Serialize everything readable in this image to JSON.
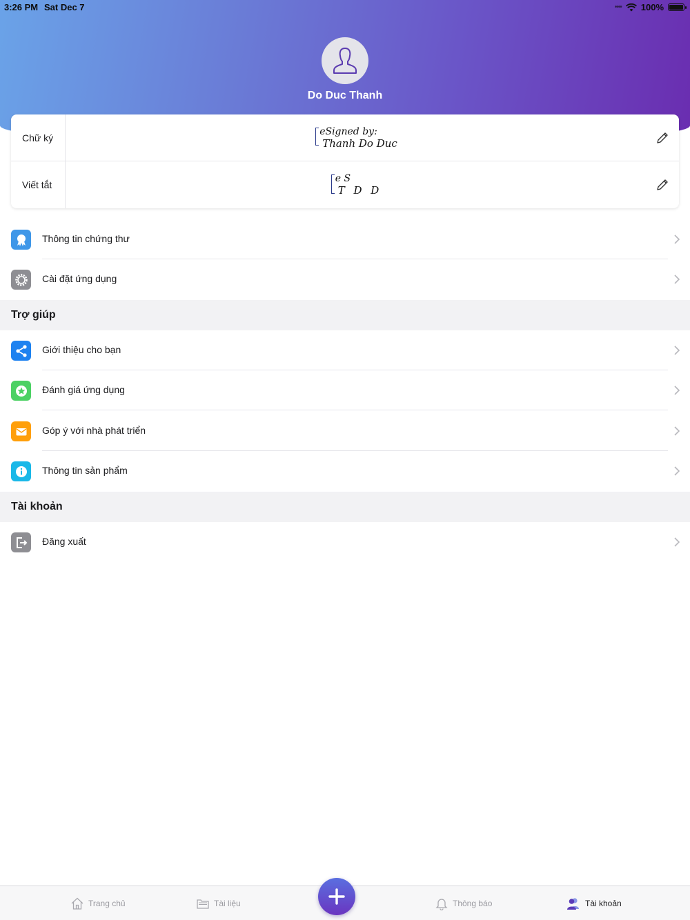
{
  "status_bar": {
    "time": "3:26 PM",
    "date": "Sat Dec 7",
    "battery": "100%"
  },
  "profile": {
    "name": "Do Duc Thanh"
  },
  "signature_card": {
    "signature_label": "Chữ ký",
    "initials_label": "Viết tắt",
    "signature_line1": "eSigned by:",
    "signature_line2": "Thanh Do Duc",
    "initials_line1": "e S",
    "initials_line2": "T D D"
  },
  "menu_main": [
    {
      "label": "Thông tin chứng thư",
      "icon": "certificate-icon",
      "color": "#3f97e8"
    },
    {
      "label": "Cài đặt ứng dụng",
      "icon": "gear-icon",
      "color": "#8e8e93"
    }
  ],
  "section_help": {
    "title": "Trợ giúp"
  },
  "menu_help": [
    {
      "label": "Giới thiệu cho bạn",
      "icon": "share-icon",
      "color": "#1e82f0"
    },
    {
      "label": "Đánh giá ứng dụng",
      "icon": "star-icon",
      "color": "#4cd164"
    },
    {
      "label": "Góp ý với nhà phát triển",
      "icon": "mail-icon",
      "color": "#ff9f0a"
    },
    {
      "label": "Thông tin sản phẩm",
      "icon": "info-icon",
      "color": "#1ab8e8"
    }
  ],
  "section_account": {
    "title": "Tài khoản"
  },
  "menu_account": [
    {
      "label": "Đăng xuất",
      "icon": "logout-icon",
      "color": "#8e8e93"
    }
  ],
  "tab_bar": {
    "tabs": [
      {
        "label": "Trang chủ",
        "icon": "home-icon",
        "active": false
      },
      {
        "label": "Tài liệu",
        "icon": "folder-icon",
        "active": false
      },
      {
        "label": "Thông báo",
        "icon": "bell-icon",
        "active": false
      },
      {
        "label": "Tài khoản",
        "icon": "account-icon",
        "active": true
      }
    ],
    "fab_icon": "plus-icon"
  },
  "colors": {
    "accent": "#6a3cc0",
    "header_start": "#6aa3e8",
    "header_end": "#6a2db0"
  }
}
